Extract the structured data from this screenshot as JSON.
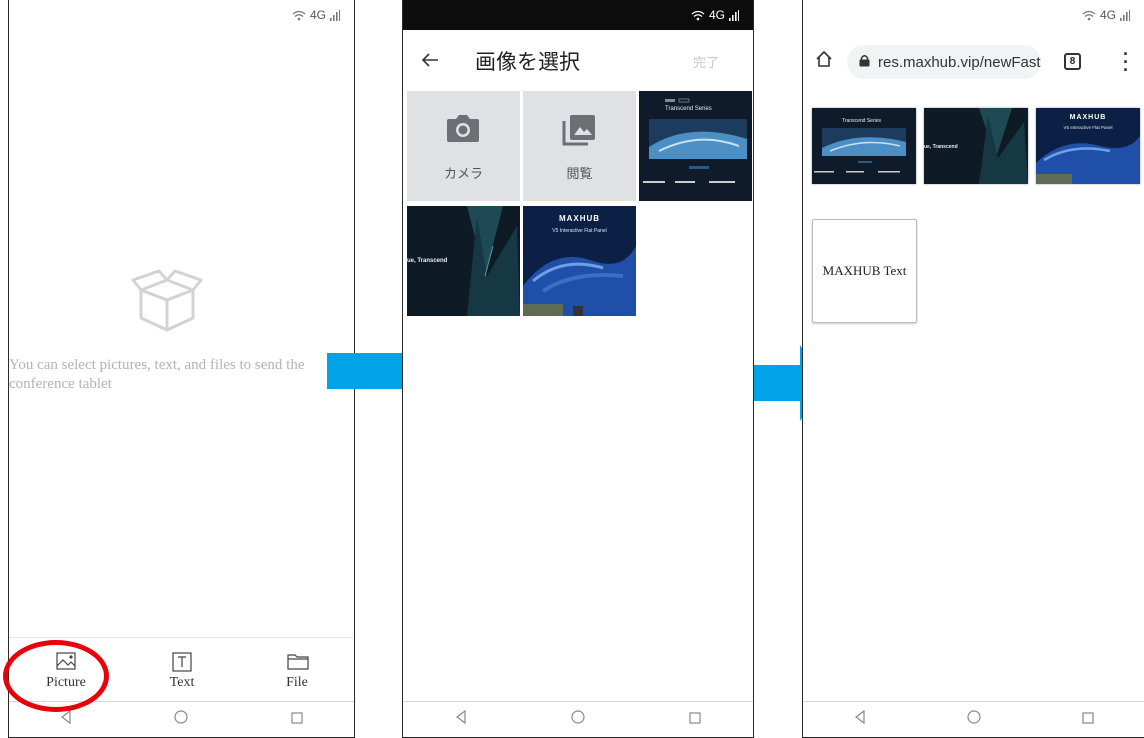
{
  "status": {
    "network": "4G"
  },
  "phone1": {
    "empty_message": "You can select pictures, text, and files to send the conference tablet",
    "tabs": [
      {
        "label": "Picture",
        "icon": "picture-icon"
      },
      {
        "label": "Text",
        "icon": "text-icon"
      },
      {
        "label": "File",
        "icon": "file-icon"
      }
    ],
    "highlight_color": "#e8000b"
  },
  "phone2": {
    "title": "画像を選択",
    "done_label": "完了",
    "tiles": [
      {
        "label": "カメラ",
        "icon": "camera-icon"
      },
      {
        "label": "閲覧",
        "icon": "gallery-icon"
      }
    ],
    "thumb_texts": {
      "transcend_series": "Transcend Series",
      "tagline": "ue, Transcend",
      "brand": "MAXHUB",
      "panel": "V5 Interactive Flat Panel"
    }
  },
  "phone3": {
    "url": "res.maxhub.vip/newFast",
    "tab_count": "8",
    "text_card": "MAXHUB Text"
  },
  "colors": {
    "arrow": "#00a3e8"
  }
}
